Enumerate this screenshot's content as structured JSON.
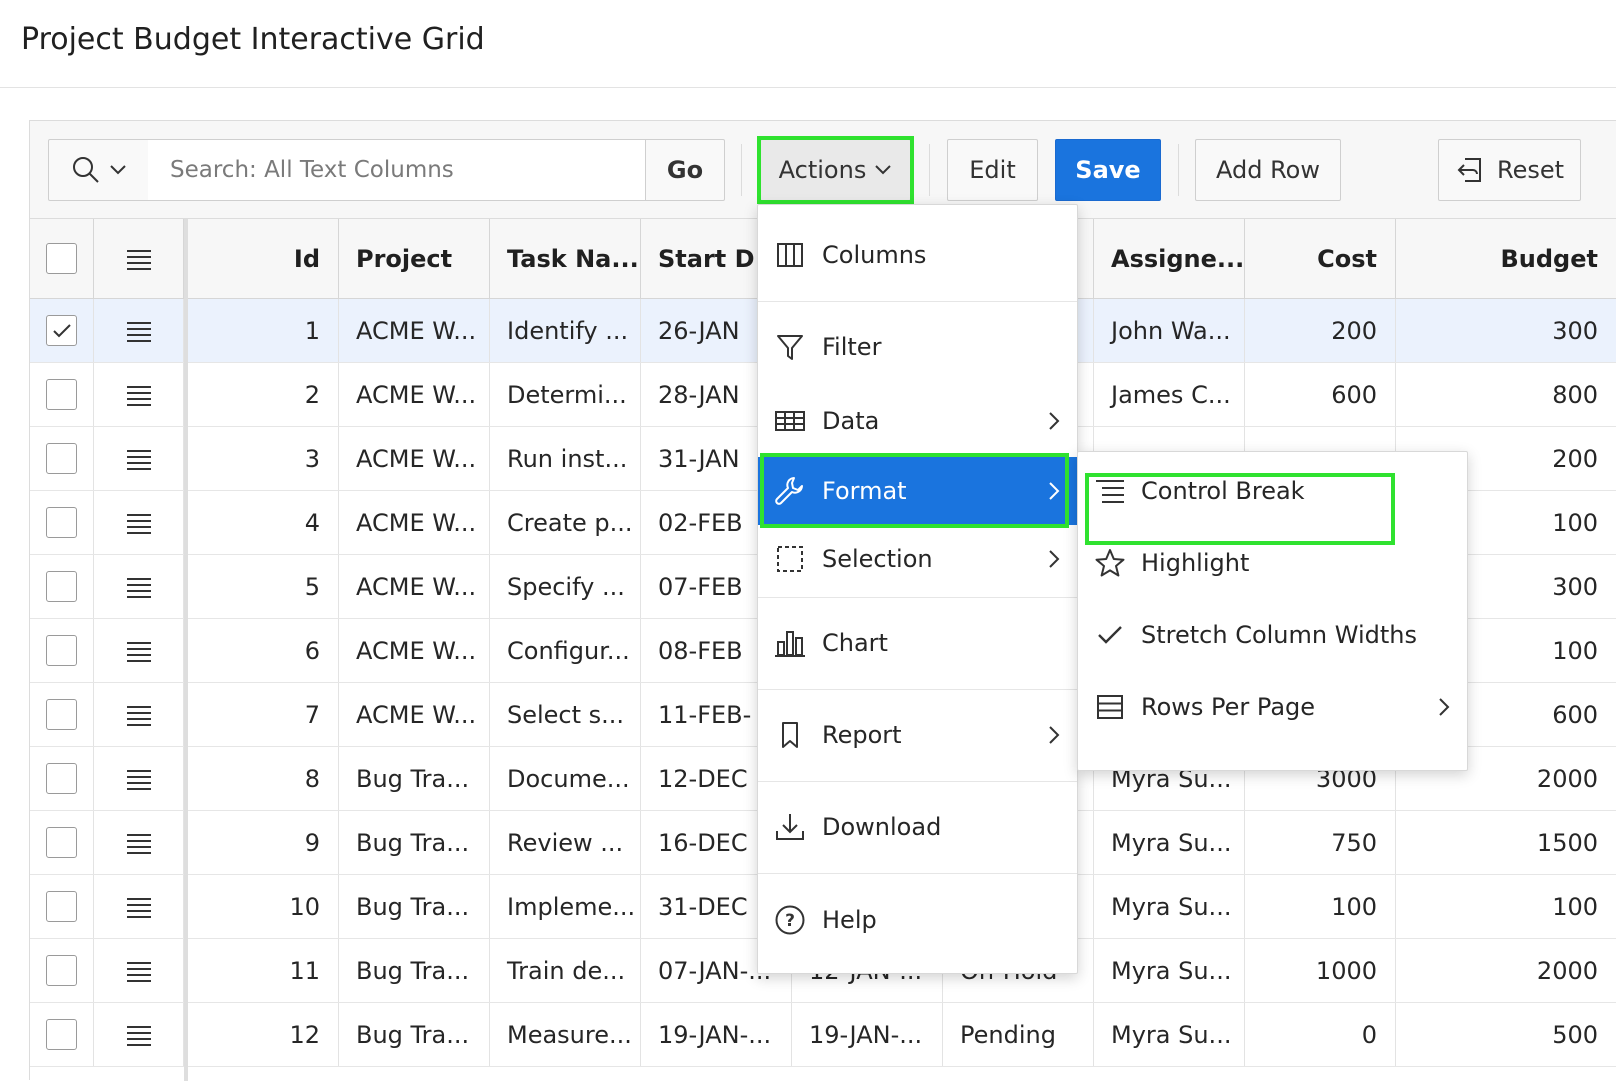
{
  "page": {
    "title": "Project Budget Interactive Grid"
  },
  "toolbar": {
    "search_placeholder": "Search: All Text Columns",
    "go_label": "Go",
    "actions_label": "Actions",
    "edit_label": "Edit",
    "save_label": "Save",
    "add_row_label": "Add Row",
    "reset_label": "Reset"
  },
  "grid": {
    "columns": [
      "Id",
      "Project",
      "Task Na...",
      "Start D",
      "",
      "",
      "Assigne...",
      "Cost",
      "Budget"
    ],
    "rows": [
      {
        "id": "1",
        "project": "ACME W...",
        "task": "Identify ...",
        "start": "26-JAN",
        "end": "",
        "status": "",
        "assignee": "John Wa...",
        "cost": "200",
        "budget": "300",
        "checked": true
      },
      {
        "id": "2",
        "project": "ACME W...",
        "task": "Determi...",
        "start": "28-JAN",
        "end": "",
        "status": "",
        "assignee": "James C...",
        "cost": "600",
        "budget": "800",
        "checked": false
      },
      {
        "id": "3",
        "project": "ACME W...",
        "task": "Run inst...",
        "start": "31-JAN",
        "end": "",
        "status": "",
        "assignee": "",
        "cost": "",
        "budget": "200",
        "checked": false
      },
      {
        "id": "4",
        "project": "ACME W...",
        "task": "Create p...",
        "start": "02-FEB",
        "end": "",
        "status": "",
        "assignee": "",
        "cost": "",
        "budget": "100",
        "checked": false
      },
      {
        "id": "5",
        "project": "ACME W...",
        "task": "Specify ...",
        "start": "07-FEB",
        "end": "",
        "status": "",
        "assignee": "",
        "cost": "",
        "budget": "300",
        "checked": false
      },
      {
        "id": "6",
        "project": "ACME W...",
        "task": "Configur...",
        "start": "08-FEB",
        "end": "",
        "status": "",
        "assignee": "",
        "cost": "",
        "budget": "100",
        "checked": false
      },
      {
        "id": "7",
        "project": "ACME W...",
        "task": "Select s...",
        "start": "11-FEB-",
        "end": "",
        "status": "",
        "assignee": "",
        "cost": "",
        "budget": "600",
        "checked": false
      },
      {
        "id": "8",
        "project": "Bug Tra...",
        "task": "Docume...",
        "start": "12-DEC",
        "end": "",
        "status": "",
        "assignee": "Myra Su...",
        "cost": "3000",
        "budget": "2000",
        "checked": false
      },
      {
        "id": "9",
        "project": "Bug Tra...",
        "task": "Review ...",
        "start": "16-DEC",
        "end": "",
        "status": "",
        "assignee": "Myra Su...",
        "cost": "750",
        "budget": "1500",
        "checked": false
      },
      {
        "id": "10",
        "project": "Bug Tra...",
        "task": "Impleme...",
        "start": "31-DEC",
        "end": "",
        "status": "",
        "assignee": "Myra Su...",
        "cost": "100",
        "budget": "100",
        "checked": false
      },
      {
        "id": "11",
        "project": "Bug Tra...",
        "task": "Train de...",
        "start": "07-JAN-...",
        "end": "12-JAN-...",
        "status": "On-Hold",
        "assignee": "Myra Su...",
        "cost": "1000",
        "budget": "2000",
        "checked": false
      },
      {
        "id": "12",
        "project": "Bug Tra...",
        "task": "Measure...",
        "start": "19-JAN-...",
        "end": "19-JAN-...",
        "status": "Pending",
        "assignee": "Myra Su...",
        "cost": "0",
        "budget": "500",
        "checked": false
      }
    ]
  },
  "actions_menu": {
    "items": [
      {
        "label": "Columns",
        "icon": "columns-icon",
        "submenu": false
      },
      {
        "label": "Filter",
        "icon": "filter-icon",
        "submenu": false
      },
      {
        "label": "Data",
        "icon": "table-icon",
        "submenu": true
      },
      {
        "label": "Format",
        "icon": "wrench-icon",
        "submenu": true,
        "active": true
      },
      {
        "label": "Selection",
        "icon": "selection-icon",
        "submenu": true
      },
      {
        "label": "Chart",
        "icon": "bar-chart-icon",
        "submenu": false
      },
      {
        "label": "Report",
        "icon": "bookmark-icon",
        "submenu": true
      },
      {
        "label": "Download",
        "icon": "download-icon",
        "submenu": false
      },
      {
        "label": "Help",
        "icon": "help-icon",
        "submenu": false
      }
    ]
  },
  "format_menu": {
    "items": [
      {
        "label": "Control Break",
        "icon": "control-break-icon",
        "submenu": false
      },
      {
        "label": "Highlight",
        "icon": "star-icon",
        "submenu": false
      },
      {
        "label": "Stretch Column Widths",
        "icon": "check-icon",
        "submenu": false
      },
      {
        "label": "Rows Per Page",
        "icon": "rows-icon",
        "submenu": true
      }
    ]
  },
  "colors": {
    "primary": "#1a74de",
    "highlight_box": "#2fe22f",
    "selected_row": "#ebf2fd"
  }
}
